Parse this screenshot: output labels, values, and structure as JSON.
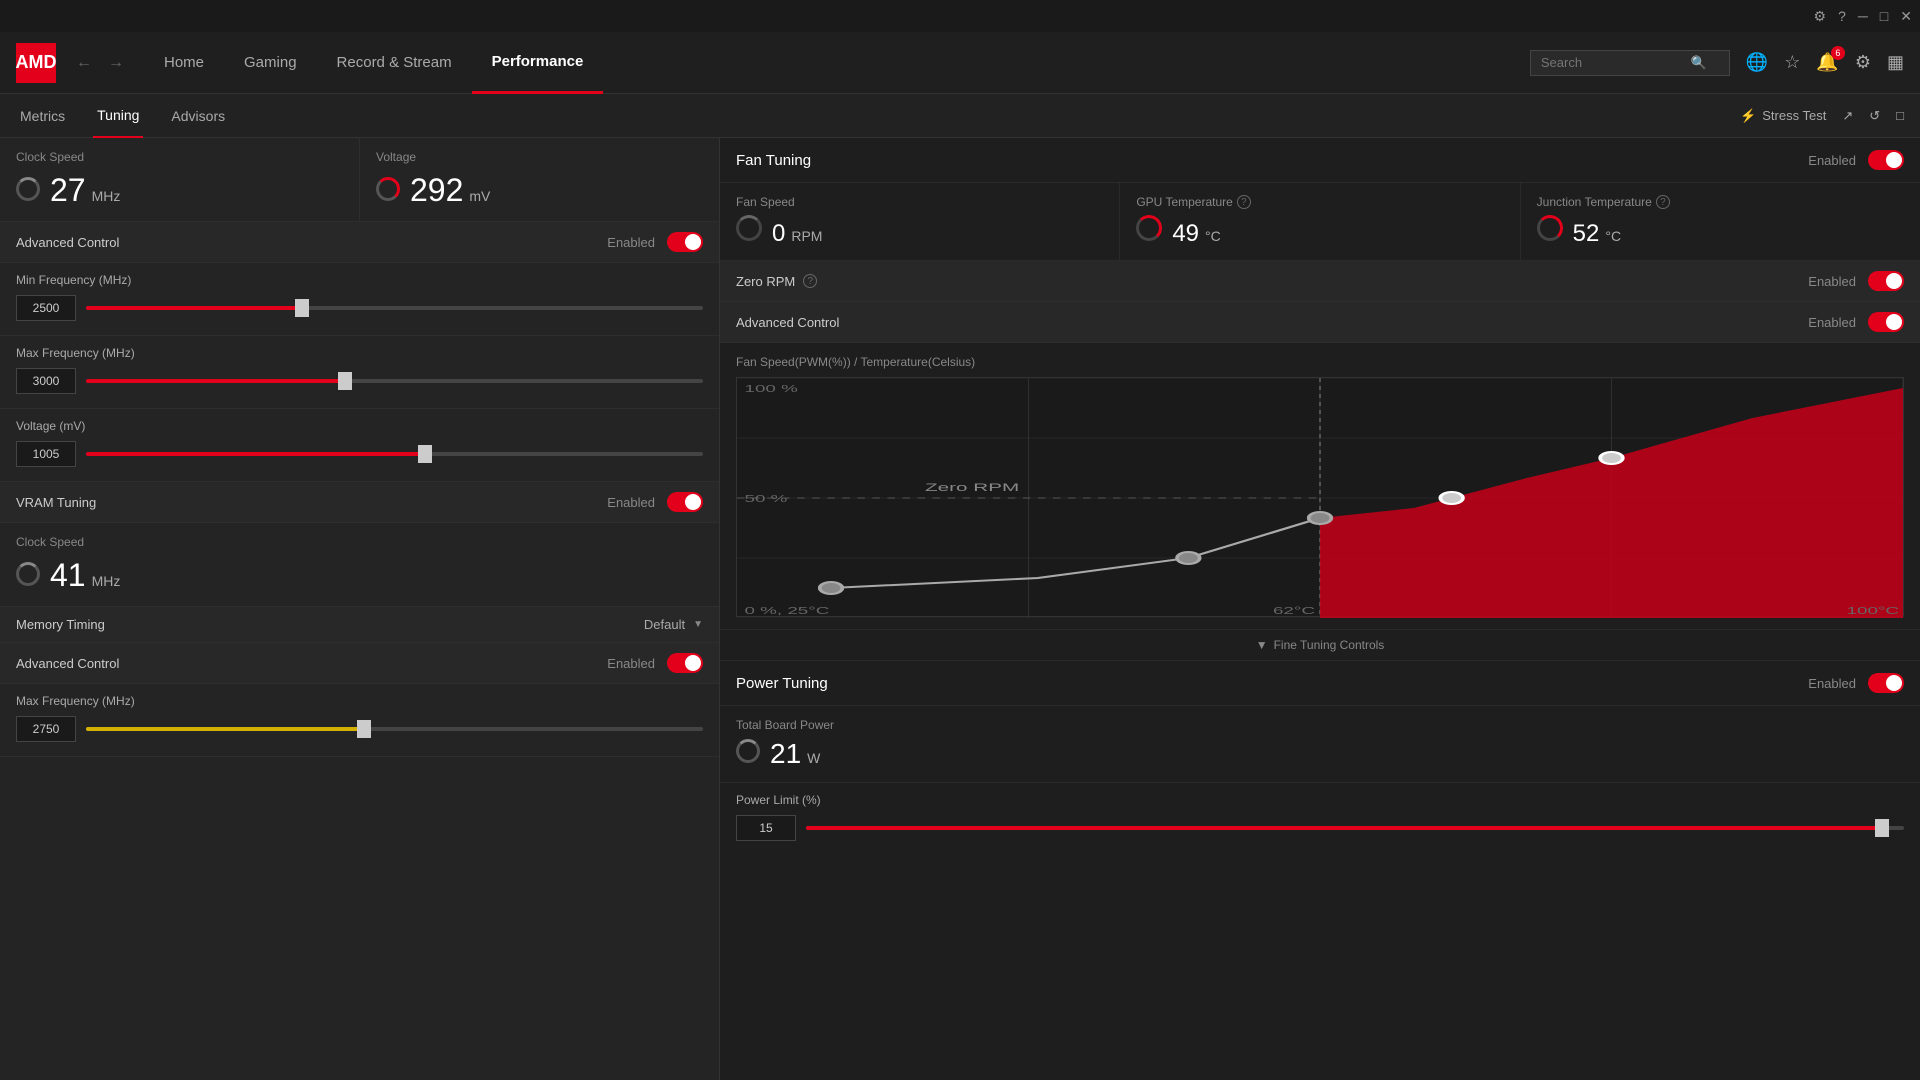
{
  "titlebar": {
    "controls": [
      "minimize",
      "maximize",
      "close"
    ]
  },
  "navbar": {
    "logo": "AMD",
    "links": [
      {
        "label": "Home",
        "active": false
      },
      {
        "label": "Gaming",
        "active": false
      },
      {
        "label": "Record & Stream",
        "active": false
      },
      {
        "label": "Performance",
        "active": true
      }
    ],
    "search_placeholder": "Search",
    "notification_badge": "6"
  },
  "subnav": {
    "links": [
      {
        "label": "Metrics",
        "active": false
      },
      {
        "label": "Tuning",
        "active": true
      },
      {
        "label": "Advisors",
        "active": false
      }
    ],
    "right": {
      "stress_test": "Stress Test"
    }
  },
  "left_panel": {
    "clock_speed": {
      "label": "Clock Speed",
      "value": "27",
      "unit": "MHz"
    },
    "voltage": {
      "label": "Voltage",
      "value": "292",
      "unit": "mV"
    },
    "advanced_control": {
      "label": "Advanced Control",
      "status": "Enabled",
      "enabled": true
    },
    "min_frequency": {
      "label": "Min Frequency (MHz)",
      "value": "2500",
      "fill_pct": 35
    },
    "max_frequency": {
      "label": "Max Frequency (MHz)",
      "value": "3000",
      "fill_pct": 42
    },
    "voltage_mv": {
      "label": "Voltage (mV)",
      "value": "1005",
      "fill_pct": 55
    },
    "vram_tuning": {
      "label": "VRAM Tuning",
      "status": "Enabled",
      "enabled": true
    },
    "vram_clock_speed": {
      "label": "Clock Speed",
      "value": "41",
      "unit": "MHz"
    },
    "memory_timing": {
      "label": "Memory Timing",
      "value": "Default"
    },
    "vram_advanced_control": {
      "label": "Advanced Control",
      "status": "Enabled",
      "enabled": true
    },
    "vram_max_frequency": {
      "label": "Max Frequency (MHz)",
      "value": "2750",
      "fill_pct": 45
    }
  },
  "right_panel": {
    "fan_tuning": {
      "title": "Fan Tuning",
      "status": "Enabled",
      "enabled": true,
      "fan_speed": {
        "label": "Fan Speed",
        "value": "0",
        "unit": "RPM"
      },
      "gpu_temp": {
        "label": "GPU Temperature",
        "value": "49",
        "unit": "°C"
      },
      "junction_temp": {
        "label": "Junction Temperature",
        "value": "52",
        "unit": "°C"
      },
      "zero_rpm": {
        "label": "Zero RPM",
        "status": "Enabled",
        "enabled": true
      },
      "advanced_control": {
        "label": "Advanced Control",
        "status": "Enabled",
        "enabled": true
      },
      "chart_title": "Fan Speed(PWM(%)) / Temperature(Celsius)",
      "chart_labels": {
        "y_top": "100 %",
        "y_mid": "50 %",
        "y_bot": "0 %, 25°C",
        "x_mid": "62°C",
        "x_right": "100°C"
      },
      "zero_rpm_label": "Zero RPM",
      "fine_tuning": "Fine Tuning Controls"
    },
    "power_tuning": {
      "title": "Power Tuning",
      "status": "Enabled",
      "enabled": true,
      "total_board_power": {
        "label": "Total Board Power",
        "value": "21",
        "unit": "W"
      },
      "power_limit": {
        "label": "Power Limit (%)",
        "value": "15",
        "fill_pct": 98
      }
    }
  }
}
